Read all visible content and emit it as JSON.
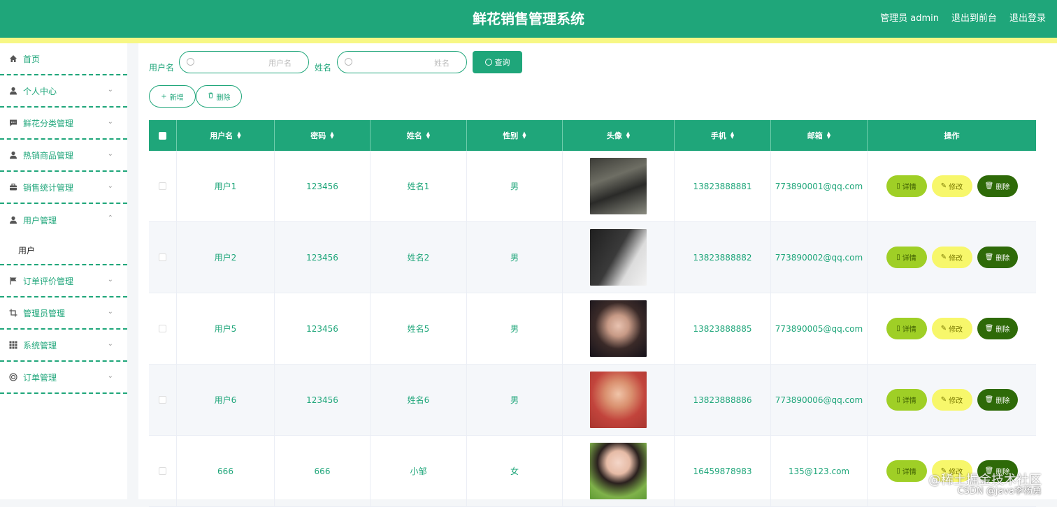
{
  "header": {
    "title": "鲜花销售管理系统",
    "admin_label": "管理员 admin",
    "to_front": "退出到前台",
    "logout": "退出登录"
  },
  "sidebar": {
    "items": [
      {
        "label": "首页",
        "icon": "home-icon",
        "expandable": false
      },
      {
        "label": "个人中心",
        "icon": "person-icon",
        "expandable": true
      },
      {
        "label": "鲜花分类管理",
        "icon": "chat-icon",
        "expandable": true
      },
      {
        "label": "热销商品管理",
        "icon": "person-icon",
        "expandable": true
      },
      {
        "label": "销售统计管理",
        "icon": "briefcase-icon",
        "expandable": true
      },
      {
        "label": "用户管理",
        "icon": "person-icon",
        "expandable": true,
        "expanded": true,
        "sub": [
          "用户"
        ]
      },
      {
        "label": "订单评价管理",
        "icon": "flag-icon",
        "expandable": true
      },
      {
        "label": "管理员管理",
        "icon": "crop-icon",
        "expandable": true
      },
      {
        "label": "系统管理",
        "icon": "grid-icon",
        "expandable": true
      },
      {
        "label": "订单管理",
        "icon": "target-icon",
        "expandable": true
      }
    ]
  },
  "search": {
    "username_label": "用户名",
    "username_placeholder": "用户名",
    "name_label": "姓名",
    "name_placeholder": "姓名",
    "query_label": "查询"
  },
  "actions": {
    "add_label": "新增",
    "delete_label": "删除"
  },
  "table": {
    "columns": [
      "用户名",
      "密码",
      "姓名",
      "性别",
      "头像",
      "手机",
      "邮箱",
      "操作"
    ],
    "rows": [
      {
        "username": "用户1",
        "password": "123456",
        "name": "姓名1",
        "gender": "男",
        "phone": "13823888881",
        "email": "773890001@qq.com"
      },
      {
        "username": "用户2",
        "password": "123456",
        "name": "姓名2",
        "gender": "男",
        "phone": "13823888882",
        "email": "773890002@qq.com"
      },
      {
        "username": "用户5",
        "password": "123456",
        "name": "姓名5",
        "gender": "男",
        "phone": "13823888885",
        "email": "773890005@qq.com"
      },
      {
        "username": "用户6",
        "password": "123456",
        "name": "姓名6",
        "gender": "男",
        "phone": "13823888886",
        "email": "773890006@qq.com"
      },
      {
        "username": "666",
        "password": "666",
        "name": "小邹",
        "gender": "女",
        "phone": "16459878983",
        "email": "135@123.com"
      }
    ],
    "op_detail": "详情",
    "op_edit": "修改",
    "op_delete": "删除"
  },
  "watermark": {
    "line1": "@稀土掘金技术社区",
    "line2": "CSDN @java李杨勇"
  },
  "colors": {
    "primary": "#1fa67a",
    "stripe": "#f7f784",
    "detail_btn": "#9fcf26",
    "edit_btn": "#f7f76b",
    "delete_btn": "#2e6a08"
  }
}
